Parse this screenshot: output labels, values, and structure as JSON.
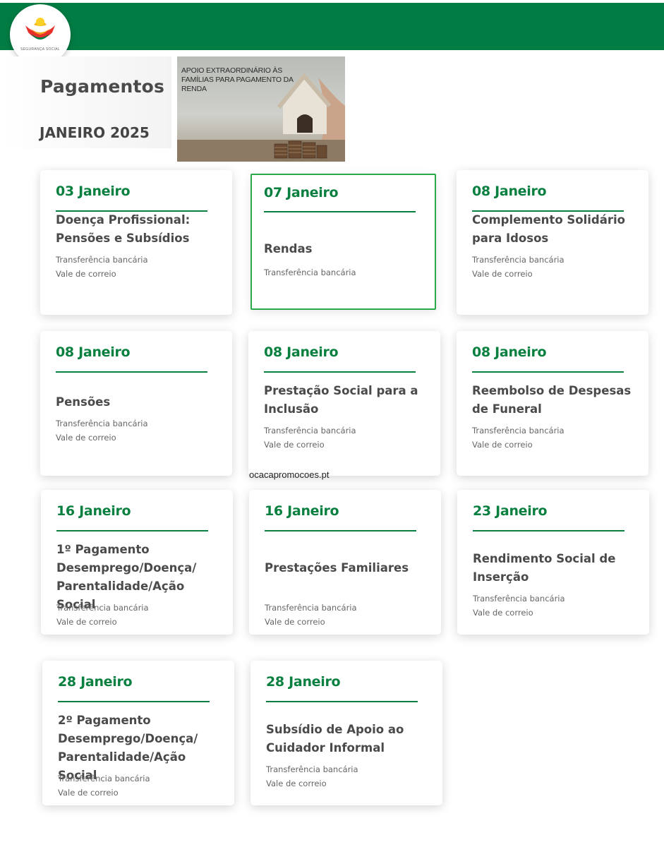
{
  "header": {
    "logo_text": "SEGURANÇA SOCIAL",
    "brand_color": "#017d44",
    "logo_icon": "seguranca-social-logo-icon"
  },
  "page": {
    "title": "Pagamentos",
    "month": "JANEIRO 2025"
  },
  "banner": {
    "text": "Apoio Extraordinário às Famílias para Pagamento da Renda"
  },
  "accent_color": "#0a8040",
  "cards": [
    {
      "date": "03 Janeiro",
      "title": "Doença Profissional: Pensões e Subsídios",
      "methods": [
        "Transferência bancária",
        "Vale de correio"
      ]
    },
    {
      "date": "07 Janeiro",
      "title": "Rendas",
      "methods": [
        "Transferência bancária"
      ],
      "selected": true
    },
    {
      "date": "08 Janeiro",
      "title": "Complemento Solidário para Idosos",
      "methods": [
        "Transferência bancária",
        "Vale de correio"
      ]
    },
    {
      "date": "08 Janeiro",
      "title": "Pensões",
      "methods": [
        "Transferência bancária",
        "Vale de correio"
      ]
    },
    {
      "date": "08 Janeiro",
      "title": "Prestação Social para a Inclusão",
      "methods": [
        "Transferência bancária",
        "Vale de correio"
      ]
    },
    {
      "date": "08 Janeiro",
      "title": "Reembolso de Despesas de Funeral",
      "methods": [
        "Transferência bancária",
        "Vale de correio"
      ]
    },
    {
      "date": "16 Janeiro",
      "title": "1º Pagamento Desemprego/Doença/ Parentalidade/Ação Social",
      "methods": [
        "Transferência bancária",
        "Vale de correio"
      ]
    },
    {
      "date": "16 Janeiro",
      "title": "Prestações Familiares",
      "methods": [
        "Transferência bancária",
        "Vale de correio"
      ]
    },
    {
      "date": "23 Janeiro",
      "title": "Rendimento Social de Inserção",
      "methods": [
        "Transferência bancária",
        "Vale de correio"
      ]
    },
    {
      "date": "28 Janeiro",
      "title": "2º Pagamento Desemprego/Doença/ Parentalidade/Ação Social",
      "methods": [
        "Transferência bancária",
        "Vale de correio"
      ]
    },
    {
      "date": "28 Janeiro",
      "title": "Subsídio de Apoio ao Cuidador Informal",
      "methods": [
        "Transferência bancária",
        "Vale de correio"
      ]
    }
  ],
  "watermark": "ocacapromocoes.pt"
}
